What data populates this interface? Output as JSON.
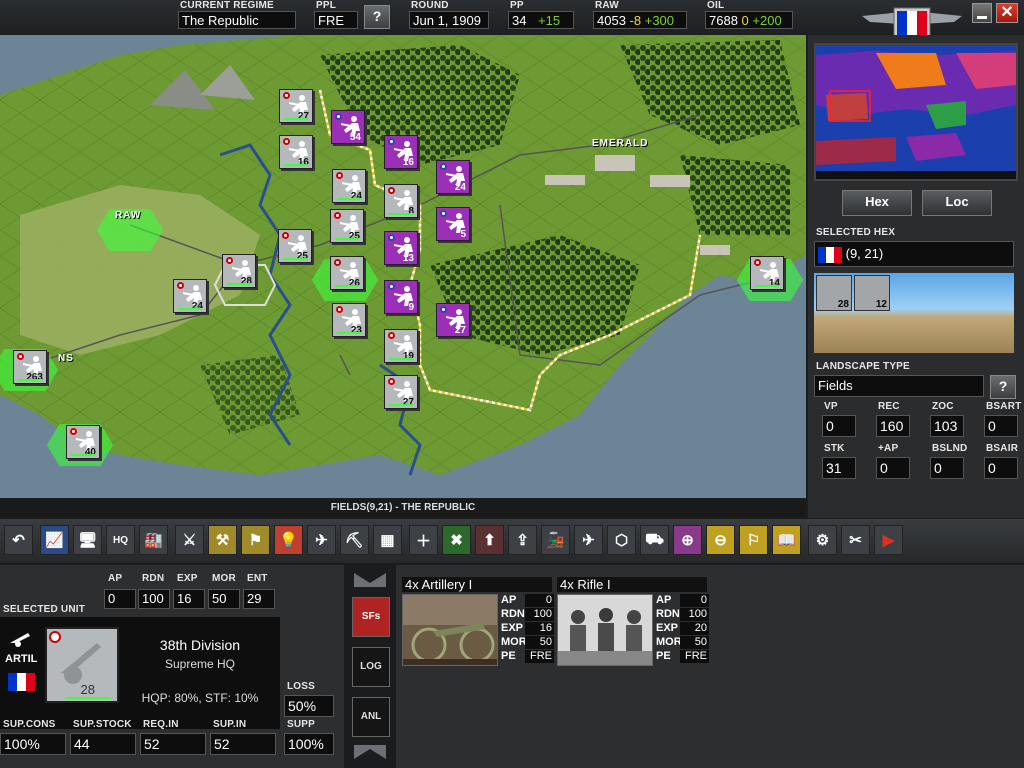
{
  "top": {
    "regime_label": "CURRENT REGIME",
    "regime": "The Republic",
    "ppl_label": "PPL",
    "ppl": "FRE",
    "help": "?",
    "round_label": "ROUND",
    "round": "Jun 1, 1909",
    "pp_label": "PP",
    "pp": "34",
    "pp_delta": "+15",
    "raw_label": "RAW",
    "raw": "4053",
    "raw_minus": "-8",
    "raw_plus": "+300",
    "oil_label": "OIL",
    "oil": "7688",
    "oil_zero": "0",
    "oil_plus": "+200"
  },
  "map": {
    "city_labels": [
      "EMERALD",
      "RAW",
      "NS"
    ],
    "status": "FIELDS(9,21) - THE REPUBLIC",
    "french_units": [
      "27",
      "16",
      "24",
      "8",
      "25",
      "28",
      "25",
      "26",
      "24",
      "23",
      "19",
      "27",
      "14",
      "263",
      "40"
    ],
    "enemy_units": [
      "54",
      "16",
      "24",
      "5",
      "13",
      "9",
      "27"
    ]
  },
  "right": {
    "hex_btn": "Hex",
    "loc_btn": "Loc",
    "selected_hex_label": "SELECTED HEX",
    "hex_coords": "(9, 21)",
    "hex_units": [
      "28",
      "12"
    ],
    "landscape_label": "LANDSCAPE TYPE",
    "landscape": "Fields",
    "help": "?",
    "stats": [
      {
        "label": "VP",
        "value": "0"
      },
      {
        "label": "REC",
        "value": "160"
      },
      {
        "label": "ZOC",
        "value": "103"
      },
      {
        "label": "BSART",
        "value": "0"
      },
      {
        "label": "STK",
        "value": "31"
      },
      {
        "label": "+AP",
        "value": "0"
      },
      {
        "label": "BSLND",
        "value": "0"
      },
      {
        "label": "BSAIR",
        "value": "0"
      }
    ]
  },
  "unit": {
    "selected_label": "SELECTED UNIT",
    "ap_label": "AP",
    "ap": "0",
    "rdn_label": "RDN",
    "rdn": "100",
    "exp_label": "EXP",
    "exp": "16",
    "mor_label": "MOR",
    "mor": "50",
    "ent_label": "ENT",
    "ent": "29",
    "type": "ARTIL",
    "strength": "28",
    "name": "38th Division",
    "hq": "Supreme HQ",
    "hqp": "HQP: 80%, STF: 10%",
    "loss_label": "LOSS",
    "loss": "50%",
    "supcons_label": "SUP.CONS",
    "supcons": "100%",
    "supstock_label": "SUP.STOCK",
    "supstock": "44",
    "reqin_label": "REQ.IN",
    "reqin": "52",
    "supin_label": "SUP.IN",
    "supin": "52",
    "supp_label": "SUPP",
    "supp": "100%"
  },
  "side_buttons": {
    "sfs": "SFs",
    "log": "LOG",
    "anl": "ANL"
  },
  "subunits": [
    {
      "title": "4x Artillery I",
      "ap": "0",
      "rdn": "100",
      "exp": "16",
      "mor": "50",
      "pe": "FRE"
    },
    {
      "title": "4x Rifle I",
      "ap": "0",
      "rdn": "100",
      "exp": "20",
      "mor": "50",
      "pe": "FRE"
    }
  ],
  "subunit_keys": {
    "ap": "AP",
    "rdn": "RDN",
    "exp": "EXP",
    "mor": "MOR",
    "pe": "PE"
  },
  "colors": {
    "french_blue": "#0033cc",
    "french_red": "#e0001a",
    "enemy_purple": "#9c2fb7",
    "selection_green": "#3cff3c",
    "map_green": "#5e8a2a",
    "sea": "#6b8596"
  },
  "icons": [
    "undo-icon",
    "graph-icon",
    "computer-icon",
    "hq-icon",
    "factory-icon",
    "rifle-icon",
    "supply-icon",
    "hq-flag-icon",
    "research-icon",
    "move-icon",
    "fortify-icon",
    "bridge-icon",
    "add-icon",
    "disband-icon",
    "upgrade-icon",
    "reinforce-icon",
    "rail-icon",
    "air-icon",
    "hex-icon",
    "deploy-icon",
    "zoom-in-icon",
    "zoom-out-icon",
    "flag-icon",
    "book-icon",
    "options-icon",
    "tools-icon",
    "end-turn-icon"
  ]
}
